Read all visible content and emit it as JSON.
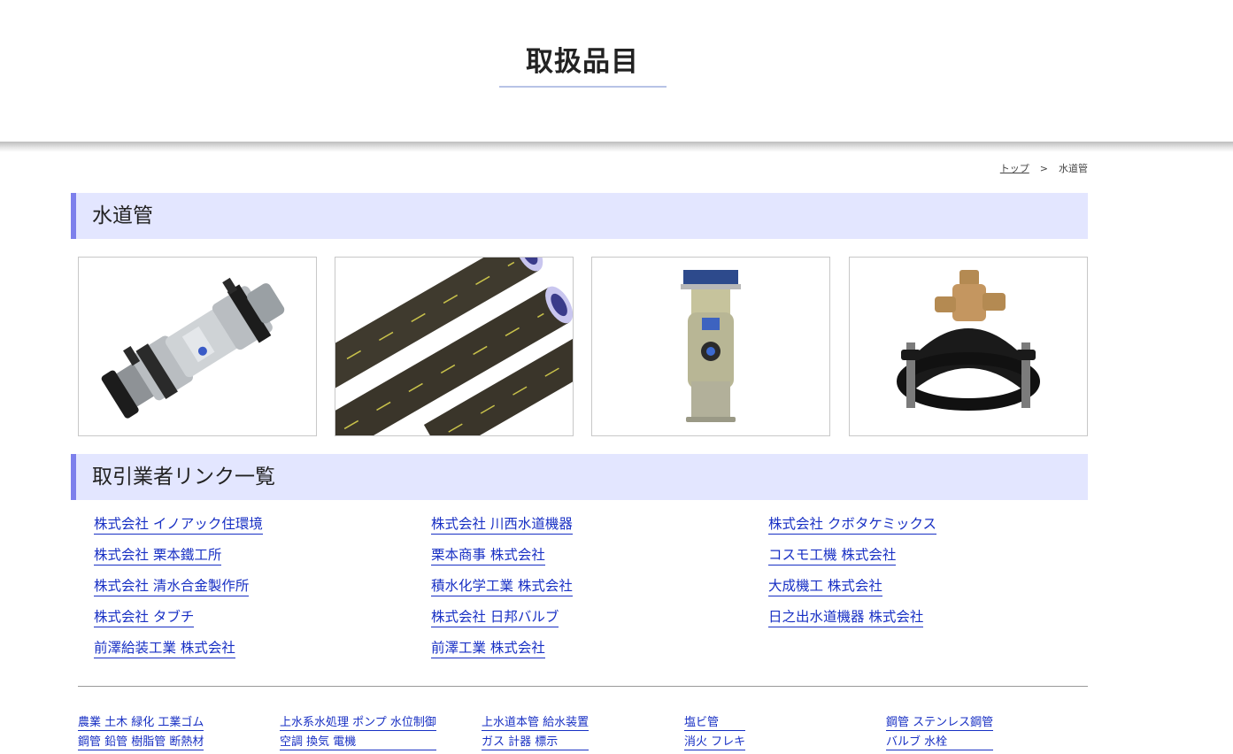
{
  "hero": {
    "title": "取扱品目"
  },
  "breadcrumb": {
    "home": "トップ",
    "separator": ">",
    "current": "水道管"
  },
  "sections": {
    "products": "水道管",
    "suppliers": "取引業者リンク一覧"
  },
  "products": [
    {
      "name": "coupling-joint"
    },
    {
      "name": "polyethylene-pipes"
    },
    {
      "name": "solar-meter-unit"
    },
    {
      "name": "saddle-valve"
    }
  ],
  "suppliers": [
    "株式会社 イノアック住環境",
    "株式会社 川西水道機器",
    "株式会社 クボタケミックス",
    "株式会社 栗本鐵工所",
    "栗本商事 株式会社",
    "コスモ工機 株式会社",
    "株式会社 清水合金製作所",
    "積水化学工業 株式会社",
    "大成機工 株式会社",
    "株式会社 タブチ",
    "株式会社 日邦バルブ",
    "日之出水道機器 株式会社",
    "前澤給装工業 株式会社",
    "前澤工業 株式会社"
  ],
  "footer_categories": [
    [
      "農業 土木 緑化 工業ゴム",
      "鋼管 鉛管 樹脂管 断熱材"
    ],
    [
      "上水系水処理 ポンプ 水位制御",
      "空調 換気 電機"
    ],
    [
      "上水道本管 給水装置",
      "ガス 計器 標示"
    ],
    [
      "塩ビ管",
      "消火 フレキ"
    ],
    [
      "鋼管 ステンレス鋼管",
      "バルブ 水栓"
    ]
  ],
  "colors": {
    "accent": "#7d80ec",
    "section_bg": "#e3e6ff",
    "link": "#1830c4"
  }
}
